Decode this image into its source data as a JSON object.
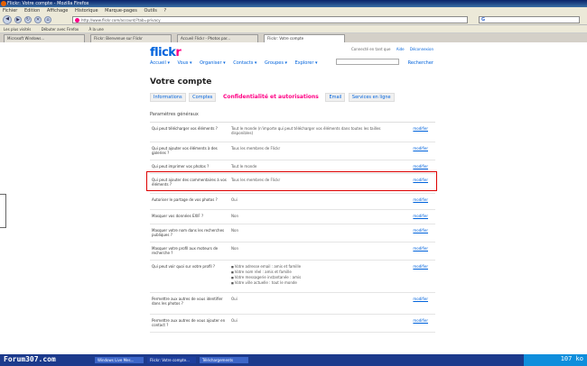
{
  "browser": {
    "title": "Flickr: Votre compte - Mozilla Firefox",
    "menu": [
      "Fichier",
      "Edition",
      "Affichage",
      "Historique",
      "Marque-pages",
      "Outils",
      "?"
    ],
    "url": "http://www.flickr.com/account/?tab=privacy",
    "bookmarks": [
      "Les plus visités",
      "Débuter avec Firefox",
      "À la une"
    ],
    "tabs": [
      "Microsoft Windows...",
      "Flickr: Bienvenue sur Flickr",
      "Accueil Flickr - Photos par...",
      "Flickr: Votre compte"
    ]
  },
  "flickr": {
    "toplinks": [
      "Connecté en tant que",
      "Aide",
      "Déconnexion"
    ],
    "logo_a": "flick",
    "logo_b": "r",
    "nav": [
      "Accueil ▾",
      "Vous ▾",
      "Organiser ▾",
      "Contacts ▾",
      "Groupes ▾",
      "Explorer ▾"
    ],
    "search_link": "Rechercher",
    "page_title": "Votre compte",
    "subtabs": [
      "Informations",
      "Comptes",
      "Confidentialité et autorisations",
      "Email",
      "Services en ligne"
    ],
    "section": "Paramètres généraux",
    "rows": [
      {
        "label": "Qui peut télécharger vos éléments ?",
        "value": "Tout le monde (n'importe qui peut télécharger vos éléments dans toutes les tailles disponibles)",
        "edit": "modifier"
      },
      {
        "label": "Qui peut ajouter vos éléments à des galeries ?",
        "value": "Tous les membres de Flickr",
        "edit": "modifier"
      },
      {
        "label": "Qui peut imprimer vos photos ?",
        "value": "Tout le monde",
        "edit": "modifier"
      },
      {
        "label": "Qui peut ajouter des commentaires à vos éléments ?",
        "value": "Tous les membres de Flickr",
        "edit": "modifier",
        "highlight": true
      },
      {
        "label": "Autoriser le partage de vos photos ?",
        "value": "Oui",
        "edit": "modifier"
      },
      {
        "label": "Masquer vos données EXIF ?",
        "value": "Non",
        "edit": "modifier"
      },
      {
        "label": "Masquer votre nom dans les recherches publiques ?",
        "value": "Non",
        "edit": "modifier"
      },
      {
        "label": "Masquer votre profil aux moteurs de recherche ?",
        "value": "Non",
        "edit": "modifier"
      },
      {
        "label": "Qui peut voir quoi sur votre profil ?",
        "value": "",
        "list": [
          "Votre adresse email : amis et famille",
          "Votre nom réel : amis et famille",
          "Votre messagerie instantanée : amis",
          "Votre ville actuelle : tout le monde"
        ],
        "edit": "modifier"
      },
      {
        "label": "Permettre aux autres de vous identifier dans les photos ?",
        "value": "Oui",
        "edit": "modifier"
      },
      {
        "label": "Permettre aux autres de vous ajouter en contact ?",
        "value": "Oui",
        "edit": "modifier"
      }
    ]
  },
  "taskbar": {
    "watermark": "Forum307.com",
    "tasks": [
      "Windows Live Mes...",
      "Flickr: Votre compte...",
      "Téléchargements"
    ],
    "tray_text": "107 ko"
  }
}
